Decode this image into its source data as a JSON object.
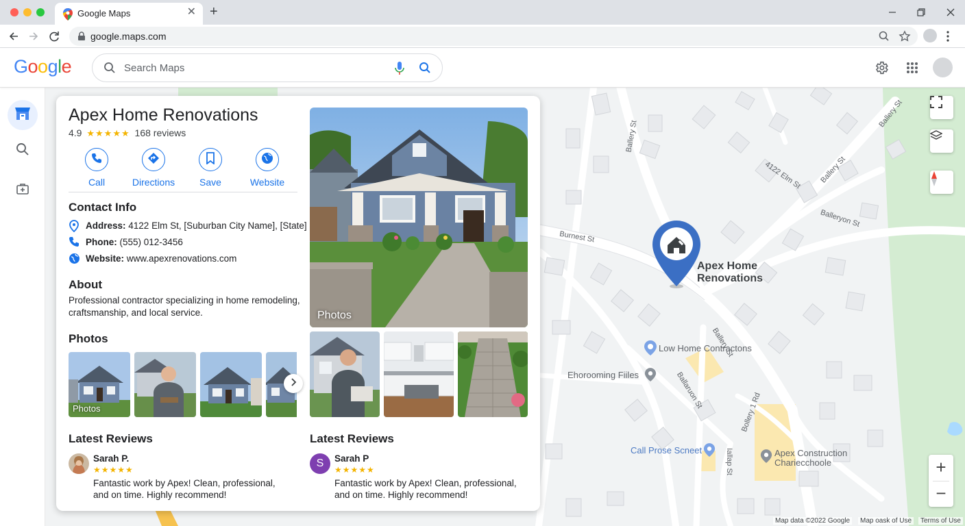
{
  "browser": {
    "tab_title": "Google Maps",
    "url": "google.maps.com",
    "new_tab_symbol": "+",
    "close_symbol": "✕"
  },
  "header": {
    "logo": [
      "G",
      "o",
      "o",
      "g",
      "l",
      "e"
    ],
    "logo_colors": [
      "#4285f4",
      "#ea4335",
      "#fbbc05",
      "#4285f4",
      "#34a853",
      "#ea4335"
    ],
    "search_placeholder": "Search Maps"
  },
  "place": {
    "name": "Apex Home Renovations",
    "rating": "4.9",
    "stars": "★★★★★",
    "reviews_count": "168 reviews",
    "actions": [
      {
        "label": "Call",
        "icon": "phone-icon"
      },
      {
        "label": "Directions",
        "icon": "directions-icon"
      },
      {
        "label": "Save",
        "icon": "bookmark-icon"
      },
      {
        "label": "Website",
        "icon": "globe-icon"
      }
    ],
    "contact_title": "Contact Info",
    "contact": [
      {
        "label": "Address:",
        "value": "4122 Elm St, [Suburban City Name], [State]",
        "icon": "location-icon"
      },
      {
        "label": "Phone:",
        "value": "(555) 012-3456",
        "icon": "phone-icon"
      },
      {
        "label": "Website:",
        "value": "www.apexrenovations.com",
        "icon": "globe-icon"
      }
    ],
    "about_title": "About",
    "about_text": "Professional contractor specializing in home remodeling, craftsmanship, and local service.",
    "photos_title": "Photos",
    "photos_thumb_caption": "Photos",
    "main_photo_caption": "Photos",
    "reviews_title_left": "Latest Reviews",
    "reviews_title_right": "Latest Reviews",
    "reviews": [
      {
        "author": "Sarah P.",
        "stars": "★★★★★",
        "text": "Fantastic work by Apex! Clean, professional, and on time. Highly recommend!"
      },
      {
        "author": "Sarah P",
        "initial": "S",
        "stars": "★★★★★",
        "text": "Fantastic work by Apex! Clean, professional, and on time. Highly recommend!"
      }
    ]
  },
  "map": {
    "pin_label_line1": "Apex Home",
    "pin_label_line2": "Renovations",
    "streets": {
      "ballery_st_1": "Ballery St",
      "ballery_st_2": "Ballery St",
      "ballery_st_3": "Ballery St",
      "elm_st": "4122 Elm St",
      "balleryon_st": "Balleryon St",
      "burnest_st": "Burnest St",
      "ballery_st_4": "Ballery St",
      "ballaruon_st": "Ballaruon St",
      "bollery_rd": "Bollery 1 Rd",
      "iallap_st": "Iallap St"
    },
    "pois": {
      "low_home": "Low Home Contractons",
      "ehorooming": "Ehorooming Fiiles",
      "call_prose": "Call Prose Scneet",
      "apex_construction_1": "Apex Construction",
      "apex_construction_2": "Chariecchoole"
    },
    "zoom_in": "+",
    "zoom_out": "−",
    "footer": {
      "map_data": "Map data ©2022 Google",
      "map_oask": "Map oask of Use",
      "terms": "Terms of Use"
    }
  },
  "colors": {
    "accent": "#1a73e8",
    "pin": "#3b6fc4",
    "star": "#f4b400",
    "park": "#d4ecd2"
  }
}
